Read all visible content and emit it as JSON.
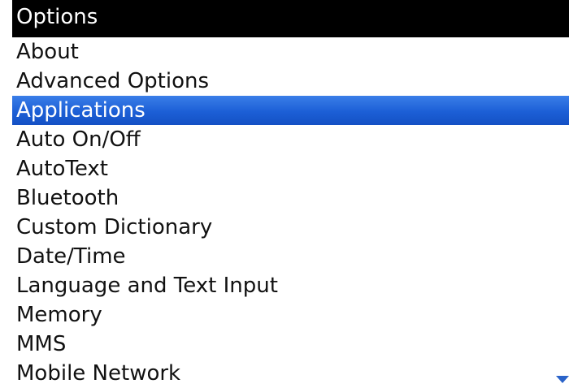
{
  "header": {
    "title": "Options"
  },
  "menu": {
    "selected_index": 2,
    "items": [
      {
        "label": "About"
      },
      {
        "label": "Advanced Options"
      },
      {
        "label": "Applications"
      },
      {
        "label": "Auto On/Off"
      },
      {
        "label": "AutoText"
      },
      {
        "label": "Bluetooth"
      },
      {
        "label": "Custom Dictionary"
      },
      {
        "label": "Date/Time"
      },
      {
        "label": "Language and Text Input"
      },
      {
        "label": "Memory"
      },
      {
        "label": "MMS"
      },
      {
        "label": "Mobile Network"
      }
    ]
  },
  "scroll_indicator": {
    "icon": "chevron-down-icon",
    "color": "#2a63c9"
  },
  "colors": {
    "title_bar": "#000000",
    "selection": "#1c5fd6",
    "text": "#111111",
    "background": "#ffffff"
  }
}
